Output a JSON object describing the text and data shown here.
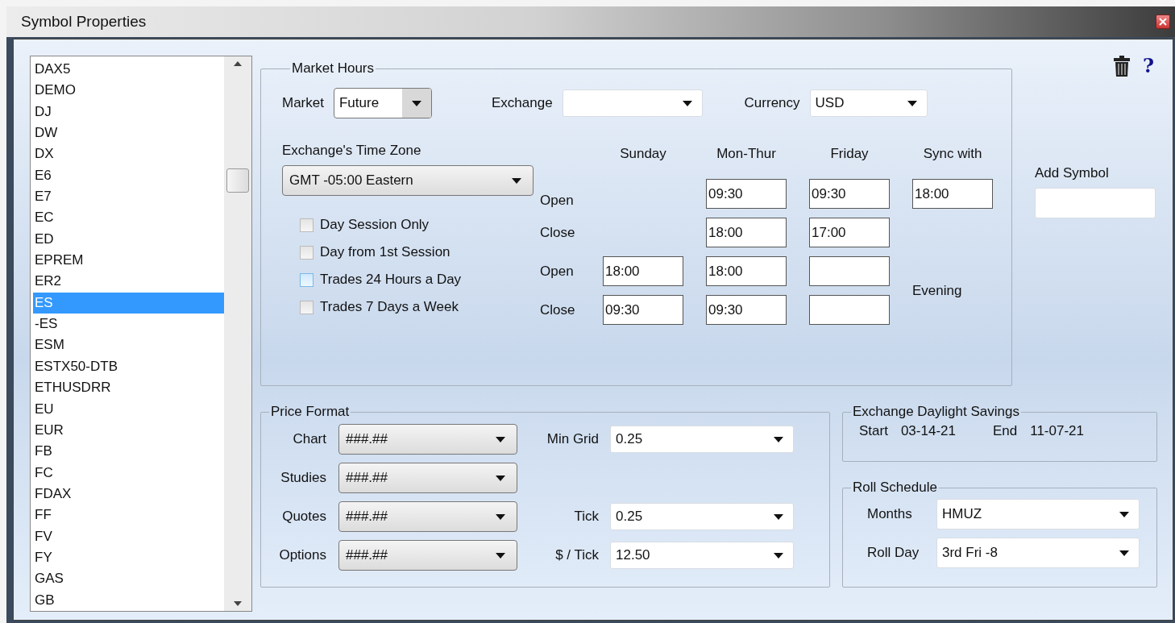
{
  "window": {
    "title": "Symbol Properties"
  },
  "symbols": [
    {
      "label": "DAX5",
      "selected": false
    },
    {
      "label": "DEMO",
      "selected": false
    },
    {
      "label": "DJ",
      "selected": false
    },
    {
      "label": "DW",
      "selected": false
    },
    {
      "label": "DX",
      "selected": false
    },
    {
      "label": "E6",
      "selected": false
    },
    {
      "label": "E7",
      "selected": false
    },
    {
      "label": "EC",
      "selected": false
    },
    {
      "label": "ED",
      "selected": false
    },
    {
      "label": "EPREM",
      "selected": false
    },
    {
      "label": "ER2",
      "selected": false
    },
    {
      "label": "ES",
      "selected": true
    },
    {
      "label": "-ES",
      "selected": false
    },
    {
      "label": "ESM",
      "selected": false
    },
    {
      "label": "ESTX50-DTB",
      "selected": false
    },
    {
      "label": "ETHUSDRR",
      "selected": false
    },
    {
      "label": "EU",
      "selected": false
    },
    {
      "label": "EUR",
      "selected": false
    },
    {
      "label": "FB",
      "selected": false
    },
    {
      "label": "FC",
      "selected": false
    },
    {
      "label": "FDAX",
      "selected": false
    },
    {
      "label": "FF",
      "selected": false
    },
    {
      "label": "FV",
      "selected": false
    },
    {
      "label": "FY",
      "selected": false
    },
    {
      "label": "GAS",
      "selected": false
    },
    {
      "label": "GB",
      "selected": false
    }
  ],
  "market_hours": {
    "title": "Market Hours",
    "selectors": [
      {
        "label": "Market",
        "value": "Future",
        "kind": "split"
      },
      {
        "label": "Exchange",
        "kind": "combo"
      },
      {
        "label": "Currency",
        "value": "USD",
        "kind": "combo"
      }
    ],
    "time_zone": {
      "label": "Exchange's Time Zone",
      "value": "GMT -05:00  Eastern",
      "kind": "button"
    },
    "options": [
      {
        "label": "Day Session Only",
        "checked": false,
        "highlighted": false
      },
      {
        "label": "Day from 1st Session",
        "checked": false,
        "highlighted": false
      },
      {
        "label": "Trades 24 Hours a Day",
        "checked": false,
        "highlighted": true
      },
      {
        "label": "Trades 7 Days a Week",
        "checked": false,
        "highlighted": false
      }
    ],
    "schedule": {
      "columns": [
        "Sunday",
        "Mon-Thur",
        "Friday",
        "Sync with"
      ],
      "rows": [
        {
          "label": "Open",
          "cells": [
            null,
            {
              "kind": "field",
              "value": "09:30"
            },
            {
              "kind": "field",
              "value": "09:30"
            },
            {
              "kind": "field",
              "value": "18:00"
            }
          ]
        },
        {
          "label": "Close",
          "cells": [
            null,
            {
              "kind": "field",
              "value": "18:00"
            },
            {
              "kind": "field",
              "value": "17:00"
            },
            null
          ]
        },
        {
          "label": "Open",
          "cells": [
            {
              "kind": "field",
              "value": "18:00"
            },
            {
              "kind": "field",
              "value": "18:00"
            },
            {
              "kind": "field"
            },
            null
          ]
        },
        {
          "label": "Close",
          "cells": [
            {
              "kind": "field",
              "value": "09:30"
            },
            {
              "kind": "field",
              "value": "09:30"
            },
            {
              "kind": "field"
            },
            null
          ]
        }
      ],
      "note": "Evening"
    }
  },
  "help": {
    "label": "?"
  },
  "add_symbol": {
    "label": "Add Symbol"
  },
  "price_format": {
    "title": "Price Format",
    "rows": [
      {
        "label": "Chart",
        "value": "###.##",
        "extra": {
          "label": "Min Grid",
          "value": "0.25"
        }
      },
      {
        "label": "Studies",
        "value": "###.##"
      },
      {
        "label": "Quotes",
        "value": "###.##",
        "extra": {
          "label": "Tick",
          "value": "0.25"
        }
      },
      {
        "label": "Options",
        "value": "###.##",
        "extra": {
          "label": "$ / Tick",
          "value": "12.50"
        }
      }
    ]
  },
  "daylight_savings": {
    "title": "Exchange Daylight Savings",
    "items": [
      {
        "label": "Start",
        "value": "03-14-21"
      },
      {
        "label": "End",
        "value": "11-07-21"
      }
    ]
  },
  "roll_schedule": {
    "title": "Roll Schedule",
    "rows": [
      {
        "label": "Months",
        "value": "HMUZ"
      },
      {
        "label": "Roll Day",
        "value": "3rd Fri -8"
      }
    ]
  }
}
